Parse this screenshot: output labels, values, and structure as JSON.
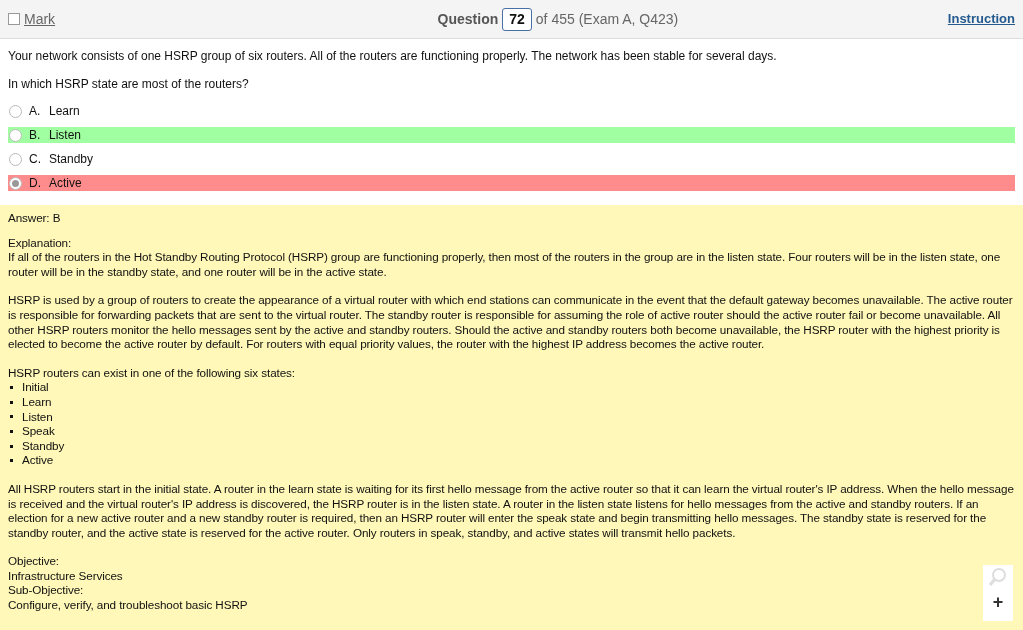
{
  "header": {
    "mark": {
      "label": "Mark",
      "checked": false
    },
    "question_label": "Question",
    "question_number": "72",
    "question_suffix": "of 455 (Exam A, Q423)",
    "instructions_link": "Instruction"
  },
  "question": [
    "Your network consists of one HSRP group of six routers. All of the routers are functioning properly. The network has been stable for several days.",
    "In which HSRP state are most of the routers?"
  ],
  "options": [
    {
      "letter": "A.",
      "text": "Learn",
      "selected": false,
      "correct": false
    },
    {
      "letter": "B.",
      "text": "Listen",
      "selected": false,
      "correct": true
    },
    {
      "letter": "C.",
      "text": "Standby",
      "selected": false,
      "correct": false
    },
    {
      "letter": "D.",
      "text": "Active",
      "selected": true,
      "correct": false
    }
  ],
  "answer": "Answer: B",
  "explanation": [
    {
      "kind": "paragraph",
      "lines": [
        "Explanation:",
        "If all of the routers in the Hot Standby Routing Protocol (HSRP) group are functioning properly, then most of the routers in the group are in the listen state. Four routers will be in the listen state, one router will be in the standby state, and one router will be in the active state."
      ]
    },
    {
      "kind": "paragraph",
      "lines": [
        "HSRP is used by a group of routers to create the appearance of a virtual router with which end stations can communicate in the event that the default gateway becomes unavailable. The active router is responsible for forwarding packets that are sent to the virtual router. The standby router is responsible for assuming the role of active router should the active router fail or become unavailable. All other HSRP routers monitor the hello messages sent by the active and standby routers. Should the active and standby routers both become unavailable, the HSRP router with the highest priority is elected to become the active router by default. For routers with equal priority values, the router with the highest IP address becomes the active router."
      ]
    },
    {
      "kind": "list",
      "intro": "HSRP routers can exist in one of the following six states:",
      "items": [
        "Initial",
        "Learn",
        "Listen",
        "Speak",
        "Standby",
        "Active"
      ]
    },
    {
      "kind": "paragraph",
      "lines": [
        "All HSRP routers start in the initial state. A router in the learn state is waiting for its first hello message from the active router so that it can learn the virtual router's IP address. When the hello message is received and the virtual router's IP address is discovered, the HSRP router is in the listen state. A router in the listen state listens for hello messages from the active and standby routers. If an election for a new active router and a new standby router is required, then an HSRP router will enter the speak state and begin transmitting hello messages. The standby state is reserved for the standby router, and the active state is reserved for the active router. Only routers in speak, standby, and active states will transmit hello packets."
      ]
    },
    {
      "kind": "paragraph",
      "lines": [
        "Objective:",
        "Infrastructure Services",
        "Sub-Objective:",
        "Configure, verify, and troubleshoot basic HSRP"
      ]
    }
  ],
  "zoom_controls": {
    "plus": "+"
  }
}
